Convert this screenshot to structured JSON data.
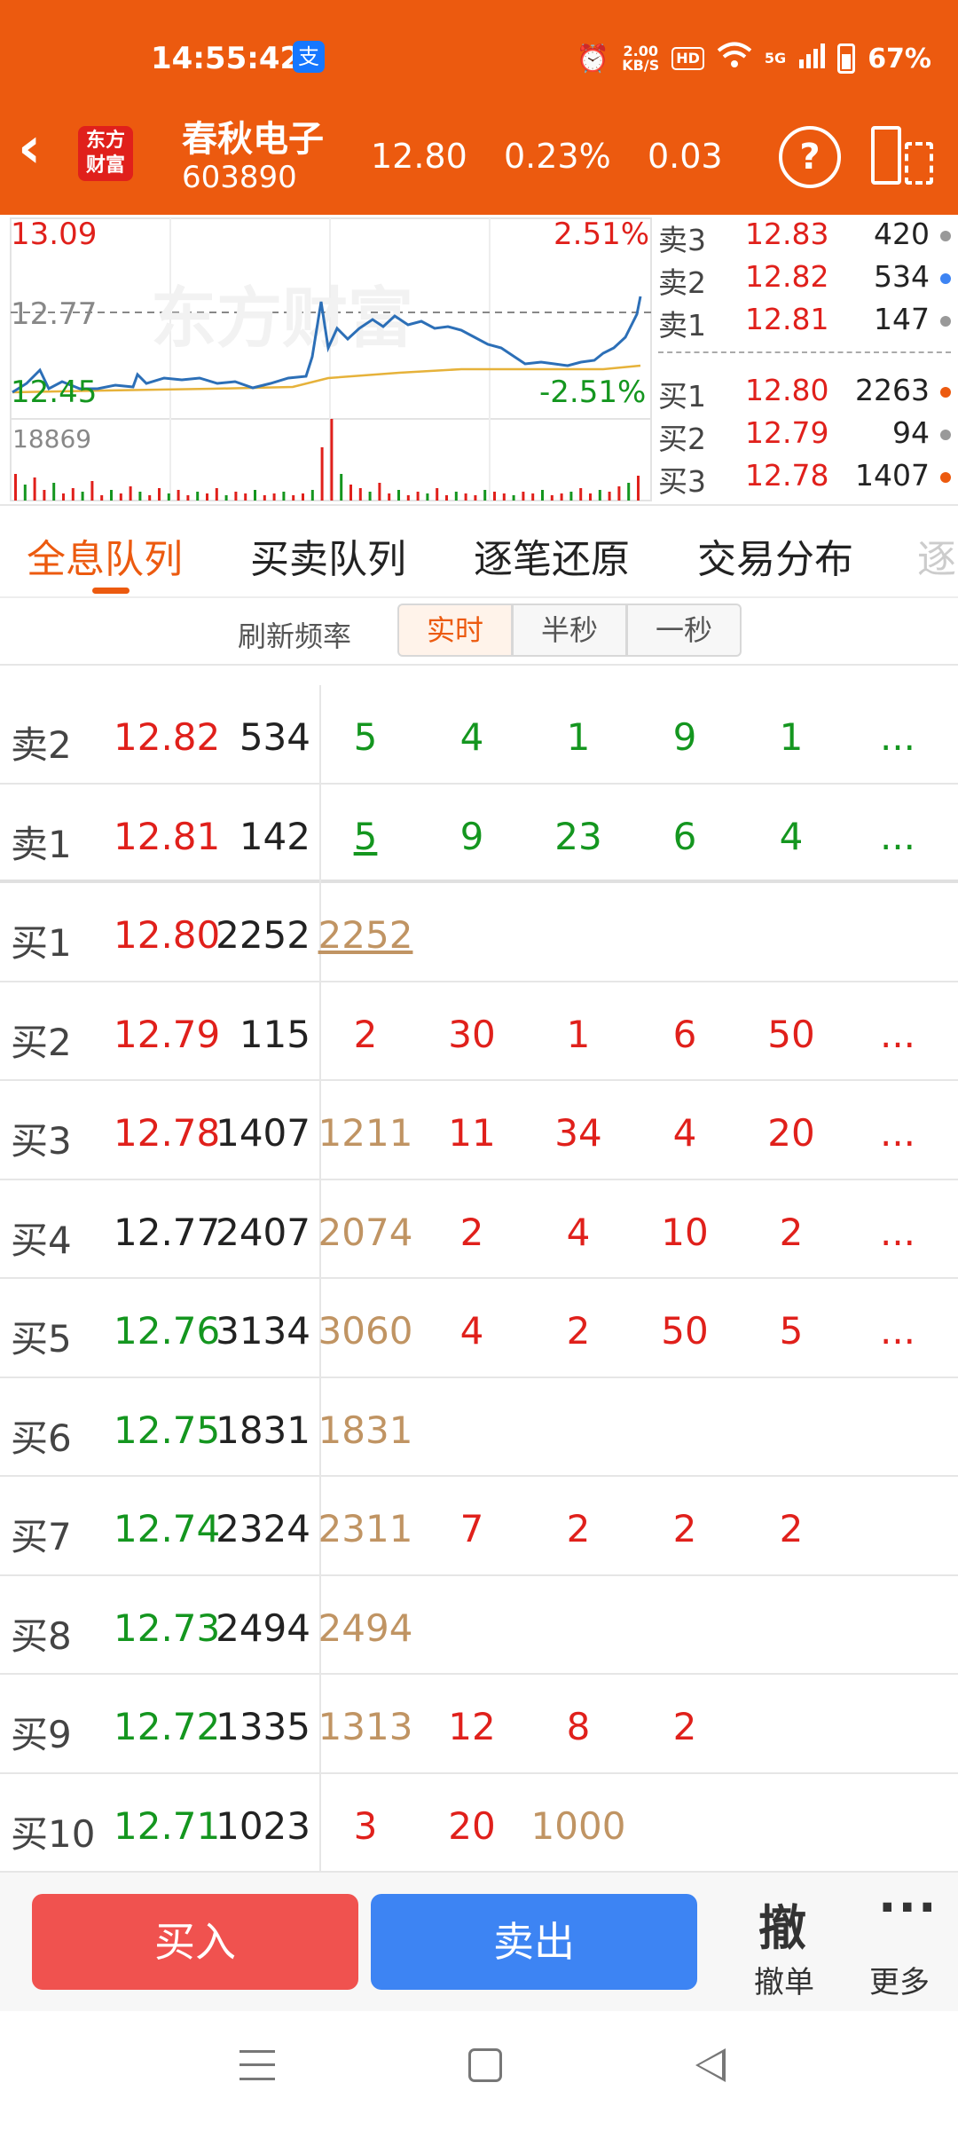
{
  "status_bar": {
    "time": "14:55:42",
    "alipay_icon": "支",
    "speed_value": "2.00",
    "speed_unit": "KB/S",
    "hd": "HD",
    "network": "5G",
    "battery": "67%"
  },
  "header": {
    "logo_line1": "东方",
    "logo_line2": "财富",
    "stock_name": "春秋电子",
    "stock_code": "603890",
    "price": "12.80",
    "change_pct": "0.23%",
    "change": "0.03"
  },
  "chart": {
    "watermark": "东方财富",
    "high_price": "13.09",
    "high_pct": "2.51%",
    "ref_price": "12.77",
    "low_price": "12.45",
    "low_pct": "-2.51%",
    "volume_max": "18869"
  },
  "order_book": {
    "asks": [
      {
        "label": "卖3",
        "price": "12.83",
        "volume": "420",
        "dot": "#999999"
      },
      {
        "label": "卖2",
        "price": "12.82",
        "volume": "534",
        "dot": "#3d84f3"
      },
      {
        "label": "卖1",
        "price": "12.81",
        "volume": "147",
        "dot": "#999999"
      }
    ],
    "bids": [
      {
        "label": "买1",
        "price": "12.80",
        "volume": "2263",
        "dot": "#ec5a0f"
      },
      {
        "label": "买2",
        "price": "12.79",
        "volume": "94",
        "dot": "#999999"
      },
      {
        "label": "买3",
        "price": "12.78",
        "volume": "1407",
        "dot": "#ec5a0f"
      }
    ]
  },
  "tabs": {
    "items": [
      "全息队列",
      "买卖队列",
      "逐笔还原",
      "交易分布",
      "逐"
    ],
    "active": "全息队列"
  },
  "refresh": {
    "label": "刷新频率",
    "options": [
      "实时",
      "半秒",
      "一秒"
    ],
    "active": "实时"
  },
  "queue_rows": [
    {
      "label": "卖2",
      "price": "12.82",
      "total": "534",
      "orders": [
        "5",
        "4",
        "1",
        "9",
        "1",
        "..."
      ]
    },
    {
      "label": "卖1",
      "price": "12.81",
      "total": "142",
      "orders": [
        "5",
        "9",
        "23",
        "6",
        "4",
        "..."
      ]
    },
    {
      "label": "买1",
      "price": "12.80",
      "total": "2252",
      "orders": [
        "2252"
      ]
    },
    {
      "label": "买2",
      "price": "12.79",
      "total": "115",
      "orders": [
        "2",
        "30",
        "1",
        "6",
        "50",
        "..."
      ]
    },
    {
      "label": "买3",
      "price": "12.78",
      "total": "1407",
      "orders": [
        "1211",
        "11",
        "34",
        "4",
        "20",
        "..."
      ]
    },
    {
      "label": "买4",
      "price": "12.77",
      "total": "2407",
      "orders": [
        "2074",
        "2",
        "4",
        "10",
        "2",
        "..."
      ]
    },
    {
      "label": "买5",
      "price": "12.76",
      "total": "3134",
      "orders": [
        "3060",
        "4",
        "2",
        "50",
        "5",
        "..."
      ]
    },
    {
      "label": "买6",
      "price": "12.75",
      "total": "1831",
      "orders": [
        "1831"
      ]
    },
    {
      "label": "买7",
      "price": "12.74",
      "total": "2324",
      "orders": [
        "2311",
        "7",
        "2",
        "2",
        "2"
      ]
    },
    {
      "label": "买8",
      "price": "12.73",
      "total": "2494",
      "orders": [
        "2494"
      ]
    },
    {
      "label": "买9",
      "price": "12.72",
      "total": "1335",
      "orders": [
        "1313",
        "12",
        "8",
        "2"
      ]
    },
    {
      "label": "买10",
      "price": "12.71",
      "total": "1023",
      "orders": [
        "3",
        "20",
        "1000"
      ]
    }
  ],
  "actions": {
    "buy": "买入",
    "sell": "卖出",
    "cancel_icon": "撤",
    "cancel": "撤单",
    "more_icon": "···",
    "more": "更多"
  },
  "colors": {
    "brand": "#ec5a0f",
    "up": "#e0201b",
    "down": "#14961f",
    "large_order": "#c09463",
    "buy": "#f0524f",
    "sell": "#3d84f3"
  }
}
